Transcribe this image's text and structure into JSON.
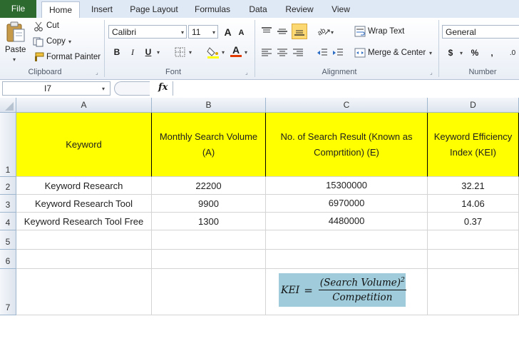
{
  "tabs": [
    "File",
    "Home",
    "Insert",
    "Page Layout",
    "Formulas",
    "Data",
    "Review",
    "View"
  ],
  "clipboard": {
    "paste": "Paste",
    "cut": "Cut",
    "copy": "Copy",
    "format_painter": "Format Painter",
    "label": "Clipboard"
  },
  "font": {
    "name": "Calibri",
    "size": "11",
    "bold": "B",
    "italic": "I",
    "underline": "U",
    "grow": "A",
    "shrink": "A",
    "color_letter": "A",
    "label": "Font"
  },
  "alignment": {
    "wrap_text": "Wrap Text",
    "merge_center": "Merge & Center",
    "label": "Alignment"
  },
  "number": {
    "format": "General",
    "currency": "$",
    "percent": "%",
    "comma": ",",
    "decimal": ".0",
    "label": "Number"
  },
  "formula_bar": {
    "name_box": "I7",
    "fx": "fx",
    "content": ""
  },
  "sheet": {
    "columns": [
      "A",
      "B",
      "C",
      "D"
    ],
    "rows": [
      "1",
      "2",
      "3",
      "4",
      "5",
      "6",
      "7"
    ],
    "header": {
      "a": "Keyword",
      "b": "Monthly Search Volume (A)",
      "c": "No. of Search Result (Known as Comprtition) (E)",
      "d": "Keyword Efficiency Index (KEI)"
    },
    "data": [
      {
        "keyword": "Keyword Research",
        "volume": "22200",
        "results": "15300000",
        "kei": "32.21"
      },
      {
        "keyword": "Keyword Research Tool",
        "volume": "9900",
        "results": "6970000",
        "kei": "14.06"
      },
      {
        "keyword": "Keyword Research Tool Free",
        "volume": "1300",
        "results": "4480000",
        "kei": "0.37"
      }
    ]
  },
  "formula_image": {
    "lhs": "KEI",
    "eq": "=",
    "numerator": "(Search Volume)",
    "exponent": "2",
    "denominator": "Competition"
  },
  "colors": {
    "file_tab": "#2d6a2f",
    "header_fill": "#ffff00",
    "formula_fill": "#9fcbda"
  }
}
